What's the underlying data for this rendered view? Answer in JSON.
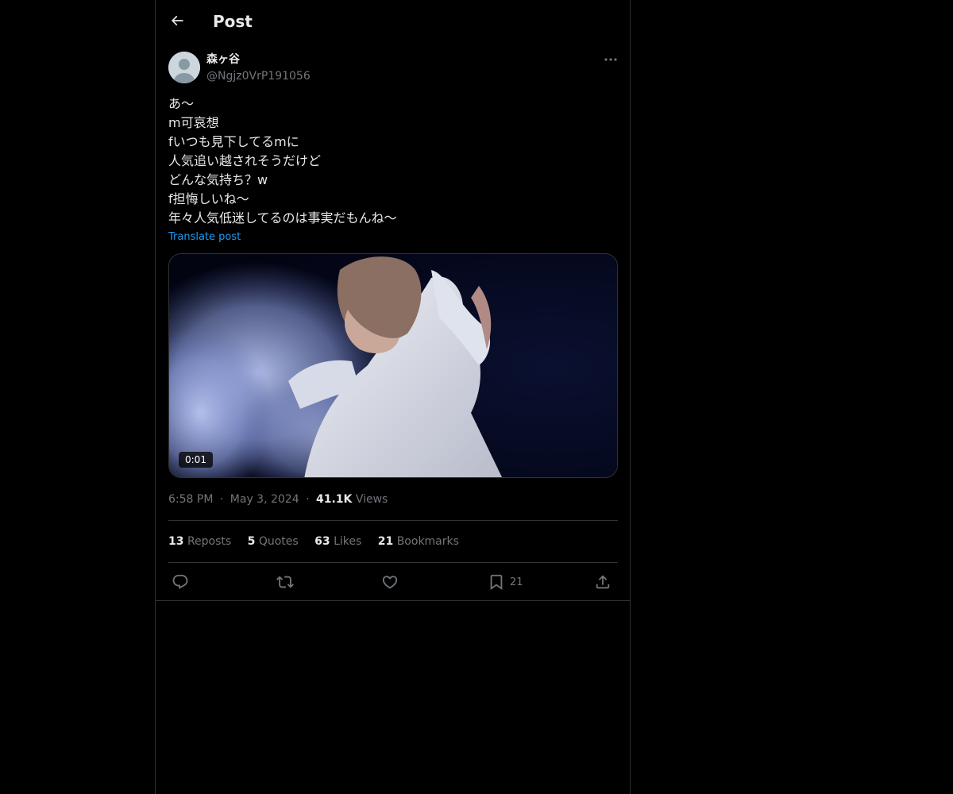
{
  "header": {
    "title": "Post"
  },
  "author": {
    "display_name": "森ヶ谷",
    "handle": "@Ngjz0VrP191056"
  },
  "post": {
    "lines": [
      "あ〜",
      "m可哀想",
      "fいつも見下してるmに",
      "人気追い越されそうだけど",
      "どんな気持ち？w",
      "f担悔しいね〜",
      "年々人気低迷してるのは事実だもんね〜"
    ],
    "translate_label": "Translate post"
  },
  "media": {
    "duration": "0:01"
  },
  "meta": {
    "time": "6:58 PM",
    "date": "May 3, 2024",
    "views_count": "41.1K",
    "views_label": "Views",
    "separator": "·"
  },
  "stats": {
    "reposts_count": "13",
    "reposts_label": "Reposts",
    "quotes_count": "5",
    "quotes_label": "Quotes",
    "likes_count": "63",
    "likes_label": "Likes",
    "bookmarks_count": "21",
    "bookmarks_label": "Bookmarks"
  },
  "actions": {
    "bookmark_count": "21"
  },
  "colors": {
    "background": "#000000",
    "text": "#e7e9ea",
    "muted": "#71767b",
    "accent": "#1d9bf0",
    "border": "#2f3336"
  },
  "icons": {
    "back": "arrow-left-icon",
    "more": "more-horizontal-icon",
    "reply": "reply-icon",
    "repost": "repost-icon",
    "like": "heart-icon",
    "bookmark": "bookmark-icon",
    "share": "share-icon"
  }
}
